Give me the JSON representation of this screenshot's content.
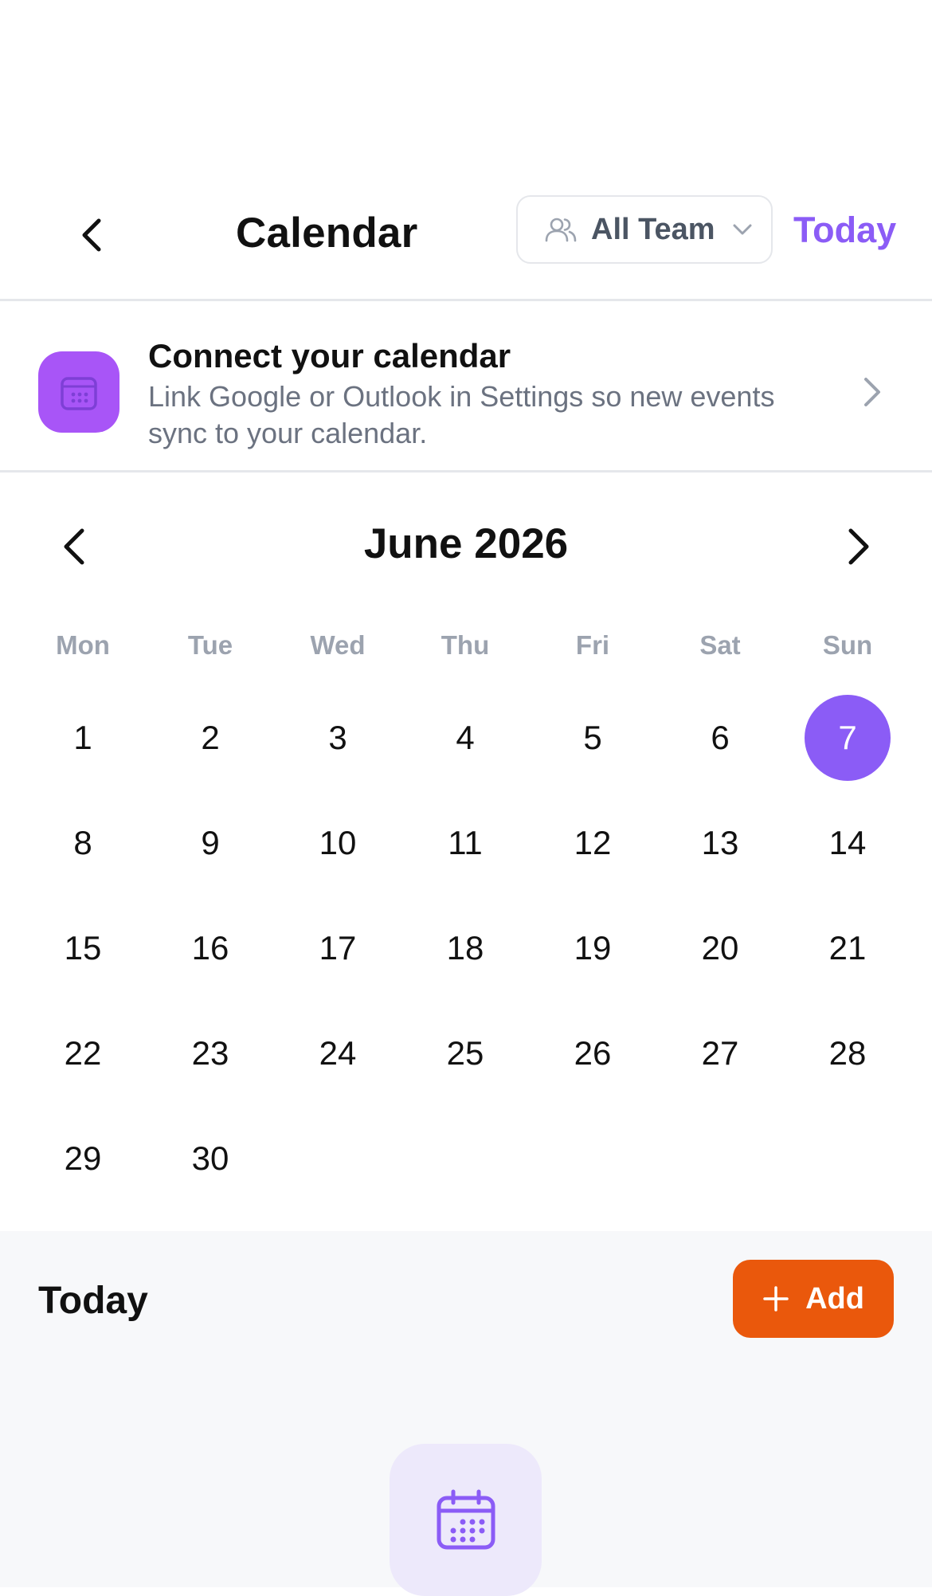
{
  "header": {
    "title": "Calendar",
    "team_filter": "All Team",
    "today_label": "Today"
  },
  "banner": {
    "title": "Connect your calendar",
    "text": "Link Google or Outlook in Settings so new events sync to your calendar."
  },
  "calendar": {
    "month_label": "June 2026",
    "weekdays": [
      "Mon",
      "Tue",
      "Wed",
      "Thu",
      "Fri",
      "Sat",
      "Sun"
    ],
    "days": [
      "1",
      "2",
      "3",
      "4",
      "5",
      "6",
      "7",
      "8",
      "9",
      "10",
      "11",
      "12",
      "13",
      "14",
      "15",
      "16",
      "17",
      "18",
      "19",
      "20",
      "21",
      "22",
      "23",
      "24",
      "25",
      "26",
      "27",
      "28",
      "29",
      "30"
    ],
    "selected_day": "7"
  },
  "today_section": {
    "heading": "Today",
    "add_label": "Add"
  },
  "colors": {
    "accent": "#8b5cf6",
    "banner_icon": "#a855f7",
    "add_button": "#ea580c"
  },
  "icons": {
    "back": "chevron-left-icon",
    "team": "users-icon",
    "dropdown": "chevron-down-icon",
    "banner": "calendar-icon",
    "banner_arrow": "chevron-right-icon",
    "prev_month": "chevron-left-icon",
    "next_month": "chevron-right-icon",
    "add": "plus-icon",
    "empty_state": "calendar-icon"
  }
}
